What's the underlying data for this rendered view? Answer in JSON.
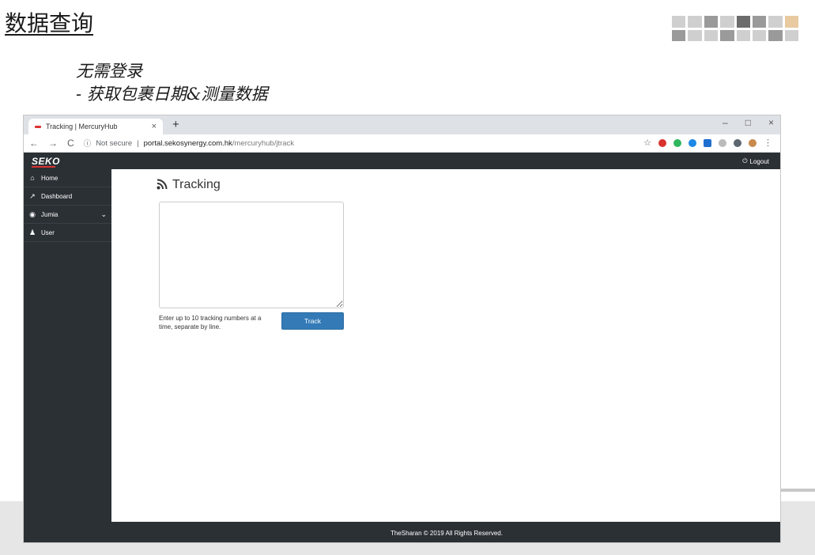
{
  "slide": {
    "title": "数据查询",
    "line1": "无需登录",
    "line2": "- 获取包裹日期&测量数据"
  },
  "browser": {
    "tab_title": "Tracking | MercuryHub",
    "tab_close": "×",
    "new_tab": "+",
    "window_controls": [
      "–",
      "□",
      "×"
    ],
    "nav": {
      "back": "←",
      "forward": "→",
      "reload": "C"
    },
    "security_label": "Not secure",
    "url_host": "portal.sekosynergy.com.hk",
    "url_path": "/mercuryhub/jtrack",
    "bookmark_icon": "☆",
    "menu_icon": "⋮",
    "extension_colors": [
      "#d9322e",
      "#2fb75f",
      "#1e88e5",
      "#1f6fd1",
      "#bbbbbb",
      "#5b6670",
      "#c7894d"
    ]
  },
  "app": {
    "brand": "SEKO",
    "logout_label": "Logout",
    "sidebar": [
      {
        "icon": "home-icon",
        "glyph": "⌂",
        "label": "Home"
      },
      {
        "icon": "chart-icon",
        "glyph": "↗",
        "label": "Dashboard"
      },
      {
        "icon": "globe-icon",
        "glyph": "◉",
        "label": "Jumia",
        "chevron": "⌄"
      },
      {
        "icon": "users-icon",
        "glyph": "♟",
        "label": "User"
      }
    ],
    "page_title": "Tracking",
    "tracking_input": {
      "value": "",
      "placeholder": ""
    },
    "help_text": "Enter up to 10 tracking numbers at a time, separate by line.",
    "track_button": "Track",
    "footer": "TheSharan © 2019 All Rights Reserved."
  },
  "colors": {
    "dark": "#2b3035",
    "primary": "#337ab7",
    "brand_red": "#d33333"
  }
}
